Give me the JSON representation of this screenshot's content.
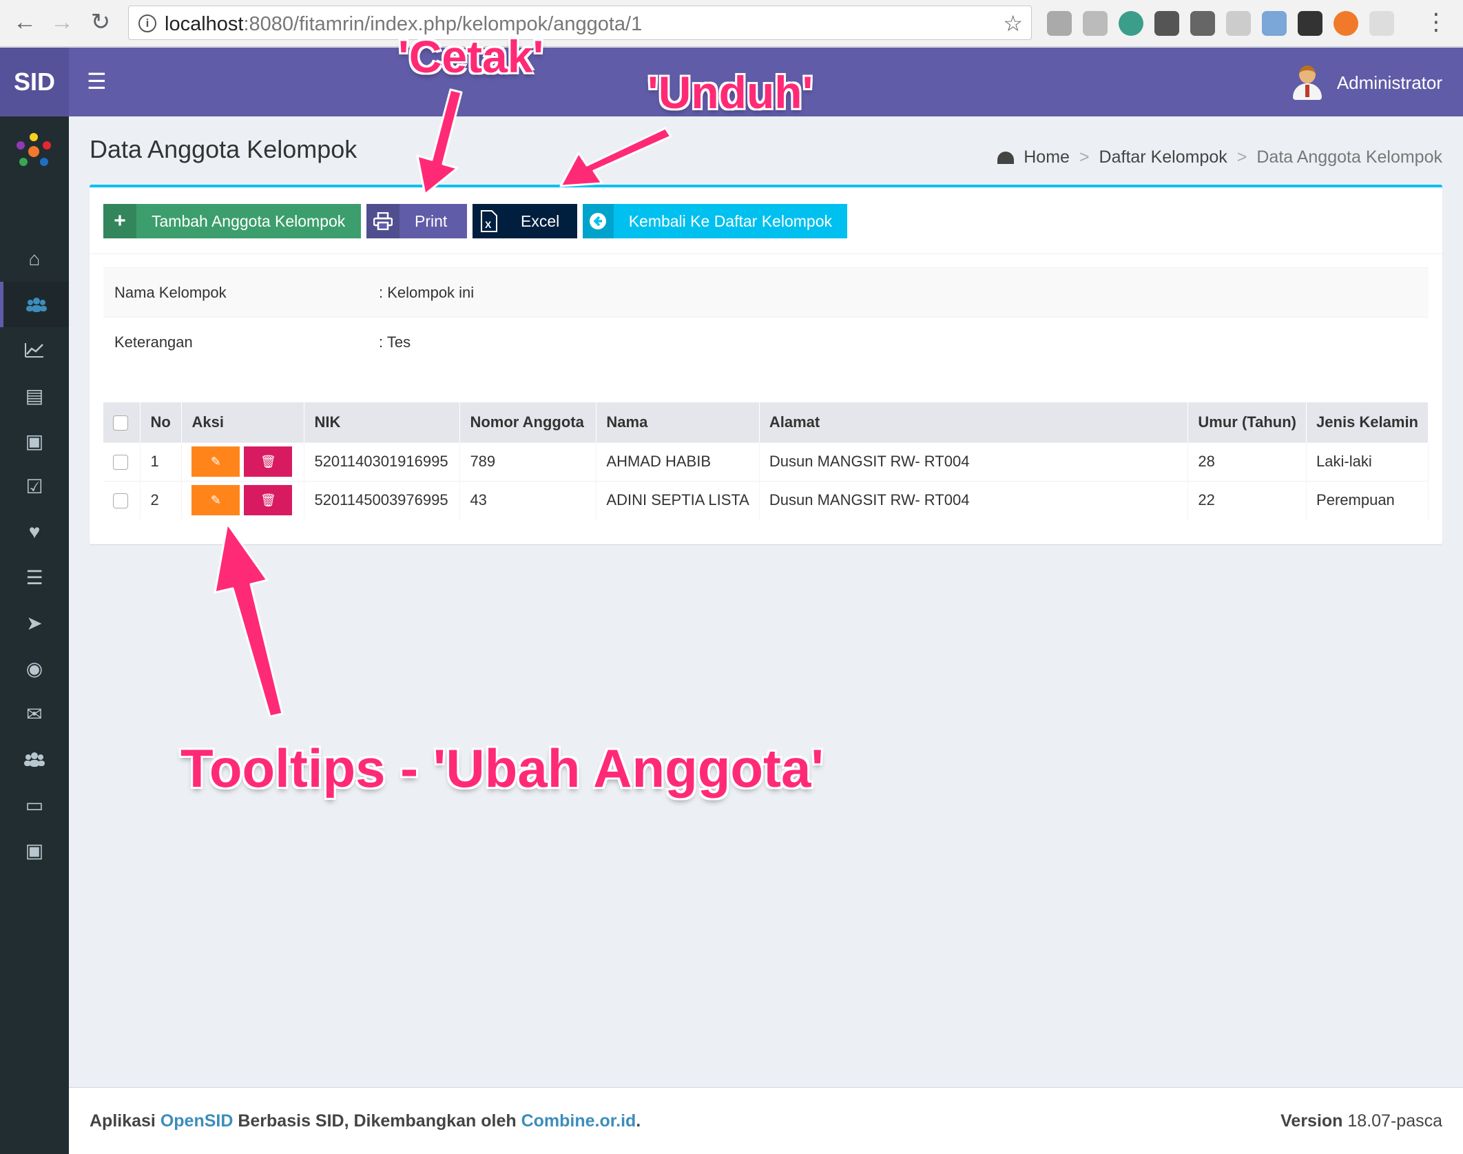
{
  "browser": {
    "url_host": "localhost",
    "url_rest": ":8080/fitamrin/index.php/kelompok/anggota/1"
  },
  "app": {
    "logo": "SID",
    "user_name": "Administrator"
  },
  "page": {
    "title": "Data Anggota Kelompok",
    "breadcrumb": [
      "Home",
      "Daftar Kelompok",
      "Data Anggota Kelompok"
    ]
  },
  "toolbar": {
    "add_label": "Tambah Anggota Kelompok",
    "print_label": "Print",
    "excel_label": "Excel",
    "back_label": "Kembali Ke Daftar Kelompok"
  },
  "info": {
    "rows": [
      {
        "label": "Nama Kelompok",
        "value": ": Kelompok ini"
      },
      {
        "label": "Keterangan",
        "value": ": Tes"
      }
    ]
  },
  "members": {
    "headers": [
      "No",
      "Aksi",
      "NIK",
      "Nomor Anggota",
      "Nama",
      "Alamat",
      "Umur (Tahun)",
      "Jenis Kelamin"
    ],
    "rows": [
      {
        "no": "1",
        "nik": "5201140301916995",
        "nomor": "789",
        "nama": "AHMAD HABIB",
        "alamat": "Dusun MANGSIT RW- RT004",
        "umur": "28",
        "jk": "Laki-laki"
      },
      {
        "no": "2",
        "nik": "5201145003976995",
        "nomor": "43",
        "nama": "ADINI SEPTIA LISTA",
        "alamat": "Dusun MANGSIT RW- RT004",
        "umur": "22",
        "jk": "Perempuan"
      }
    ]
  },
  "footer": {
    "prefix": "Aplikasi ",
    "app_link": "OpenSID",
    "middle": " Berbasis SID, Dikembangkan oleh ",
    "org_link": "Combine.or.id",
    "suffix": ".",
    "version_label": "Version",
    "version_value": " 18.07-pasca"
  },
  "annotations": {
    "cetak": "'Cetak'",
    "unduh": "'Unduh'",
    "tooltip": "Tooltips - 'Ubah Anggota'"
  },
  "colors": {
    "header": "#605ca8",
    "sidebar": "#222d32",
    "accent": "#00c0ef",
    "annotation": "#ff2a76"
  }
}
